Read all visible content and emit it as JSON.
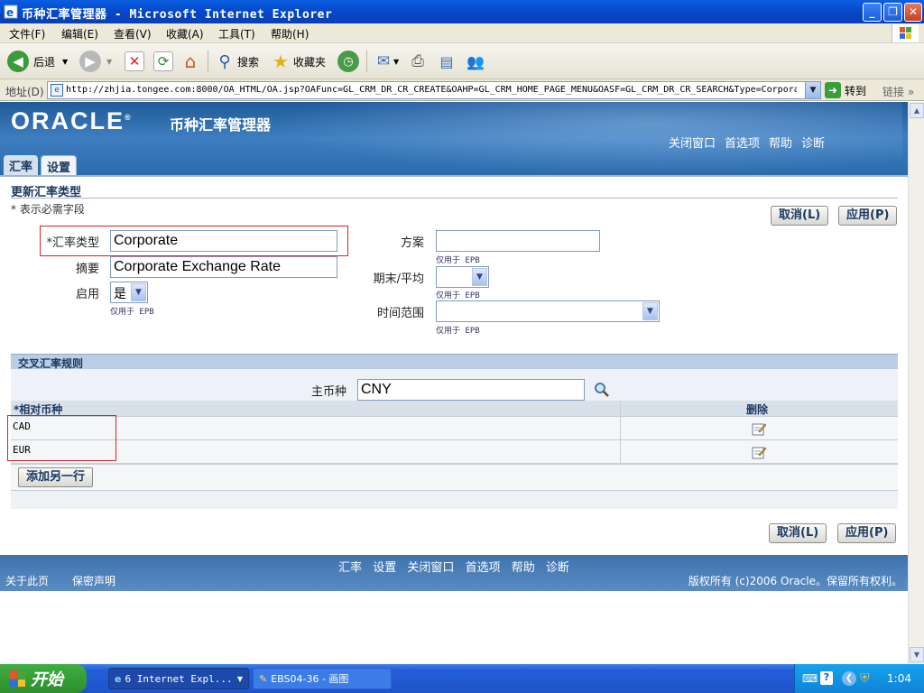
{
  "window": {
    "title": "币种汇率管理器 - Microsoft Internet Explorer"
  },
  "menu": [
    "文件(F)",
    "编辑(E)",
    "查看(V)",
    "收藏(A)",
    "工具(T)",
    "帮助(H)"
  ],
  "toolbar": {
    "back_label": "后退",
    "search_label": "搜索",
    "favorites_label": "收藏夹"
  },
  "address": {
    "label": "地址(D)",
    "url": "http://zhjia.tongee.com:8000/OA_HTML/OA.jsp?OAFunc=GL_CRM_DR_CR_CREATE&OAHP=GL_CRM_HOME_PAGE_MENU&OASF=GL_CRM_DR_CR_SEARCH&Type=Corporat",
    "go_label": "转到",
    "links_label": "链接"
  },
  "header": {
    "logo": "ORACLE",
    "app_title": "币种汇率管理器",
    "global_links": [
      "关闭窗口",
      "首选项",
      "帮助",
      "诊断"
    ],
    "tabs": [
      "汇率",
      "设置"
    ]
  },
  "page": {
    "title": "更新汇率类型",
    "required_note": "* 表示必需字段",
    "cancel_label": "取消(L)",
    "apply_label": "应用(P)"
  },
  "form": {
    "rate_type_label": "汇率类型",
    "rate_type_value": "Corporate",
    "summary_label": "摘要",
    "summary_value": "Corporate Exchange Rate",
    "enabled_label": "启用",
    "enabled_value": "是",
    "epb_note": "仅用于 EPB",
    "scheme_label": "方案",
    "scheme_value": "",
    "period_label": "期末/平均",
    "period_value": "",
    "time_range_label": "时间范围",
    "time_range_value": ""
  },
  "cross": {
    "section_title": "交叉汇率规则",
    "base_currency_label": "主币种",
    "base_currency_value": "CNY",
    "col_currency": "*相对币种",
    "col_delete": "删除",
    "rows": [
      "CAD",
      "EUR"
    ],
    "add_row_label": "添加另一行"
  },
  "footer": {
    "links": [
      "汇率",
      "设置",
      "关闭窗口",
      "首选项",
      "帮助",
      "诊断"
    ],
    "about": "关于此页",
    "privacy": "保密声明",
    "copyright": "版权所有 (c)2006 Oracle。保留所有权利。"
  },
  "taskbar": {
    "start_label": "开始",
    "tasks": [
      "6 Internet Expl...",
      "EBS04-36 - 画图"
    ],
    "clock": "1:04"
  }
}
